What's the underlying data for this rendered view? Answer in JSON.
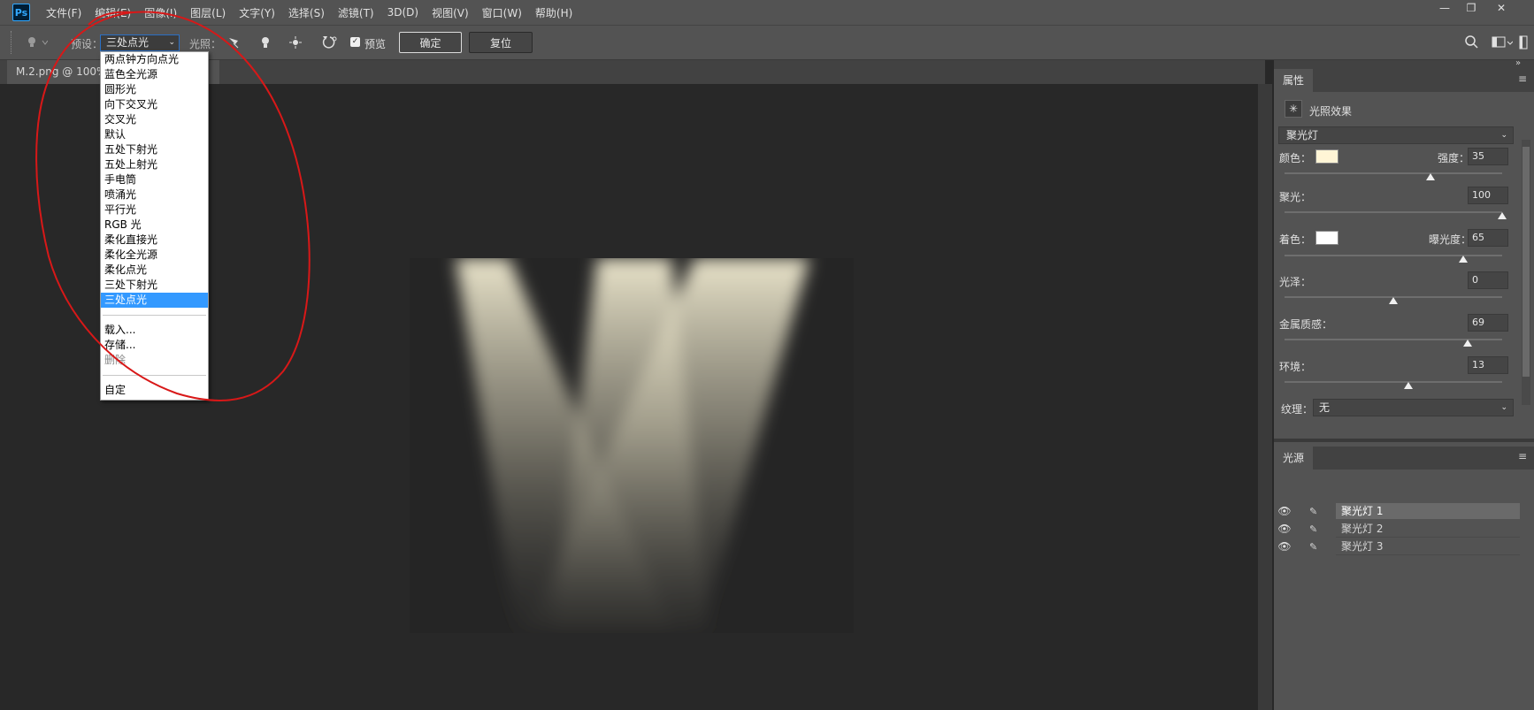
{
  "app": {
    "logo": "Ps"
  },
  "menu": [
    "文件(F)",
    "编辑(E)",
    "图像(I)",
    "图层(L)",
    "文字(Y)",
    "选择(S)",
    "滤镜(T)",
    "3D(D)",
    "视图(V)",
    "窗口(W)",
    "帮助(H)"
  ],
  "window_controls": {
    "minimize": "—",
    "maximize": "❐",
    "close": "✕"
  },
  "options": {
    "preset_label": "预设：",
    "preset_value": "三处点光",
    "light_label": "光照：",
    "preview_label": "预览",
    "ok_label": "确定",
    "reset_label": "复位"
  },
  "document": {
    "tab": "M.2.png @ 100%"
  },
  "preset_menu": {
    "items": [
      "两点钟方向点光",
      "蓝色全光源",
      "圆形光",
      "向下交叉光",
      "交叉光",
      "默认",
      "五处下射光",
      "五处上射光",
      "手电筒",
      "喷涌光",
      "平行光",
      "RGB 光",
      "柔化直接光",
      "柔化全光源",
      "柔化点光",
      "三处下射光",
      "三处点光"
    ],
    "selected_index": 16,
    "load": "载入...",
    "save": "存储...",
    "delete": "删除",
    "custom": "自定"
  },
  "properties": {
    "tab": "属性",
    "title": "光照效果",
    "light_type": "聚光灯",
    "color_label": "颜色：",
    "intensity_label": "强度：",
    "intensity": "35",
    "hotspot_label": "聚光：",
    "hotspot": "100",
    "colorize_label": "着色：",
    "exposure_label": "曝光度：",
    "exposure": "65",
    "gloss_label": "光泽：",
    "gloss": "0",
    "metallic_label": "金属质感：",
    "metallic": "69",
    "ambience_label": "环境：",
    "ambience": "13",
    "texture_label": "纹理：",
    "texture": "无",
    "colors": {
      "light": "#fff5d6",
      "colorize": "#ffffff"
    }
  },
  "slider_levels": {
    "intensity": 0.67,
    "hotspot": 1.0,
    "exposure": 0.82,
    "gloss": 0.5,
    "metallic": 0.84,
    "ambience": 0.57
  },
  "lights": {
    "tab": "光源",
    "items": [
      "聚光灯 1",
      "聚光灯 2",
      "聚光灯 3"
    ]
  }
}
